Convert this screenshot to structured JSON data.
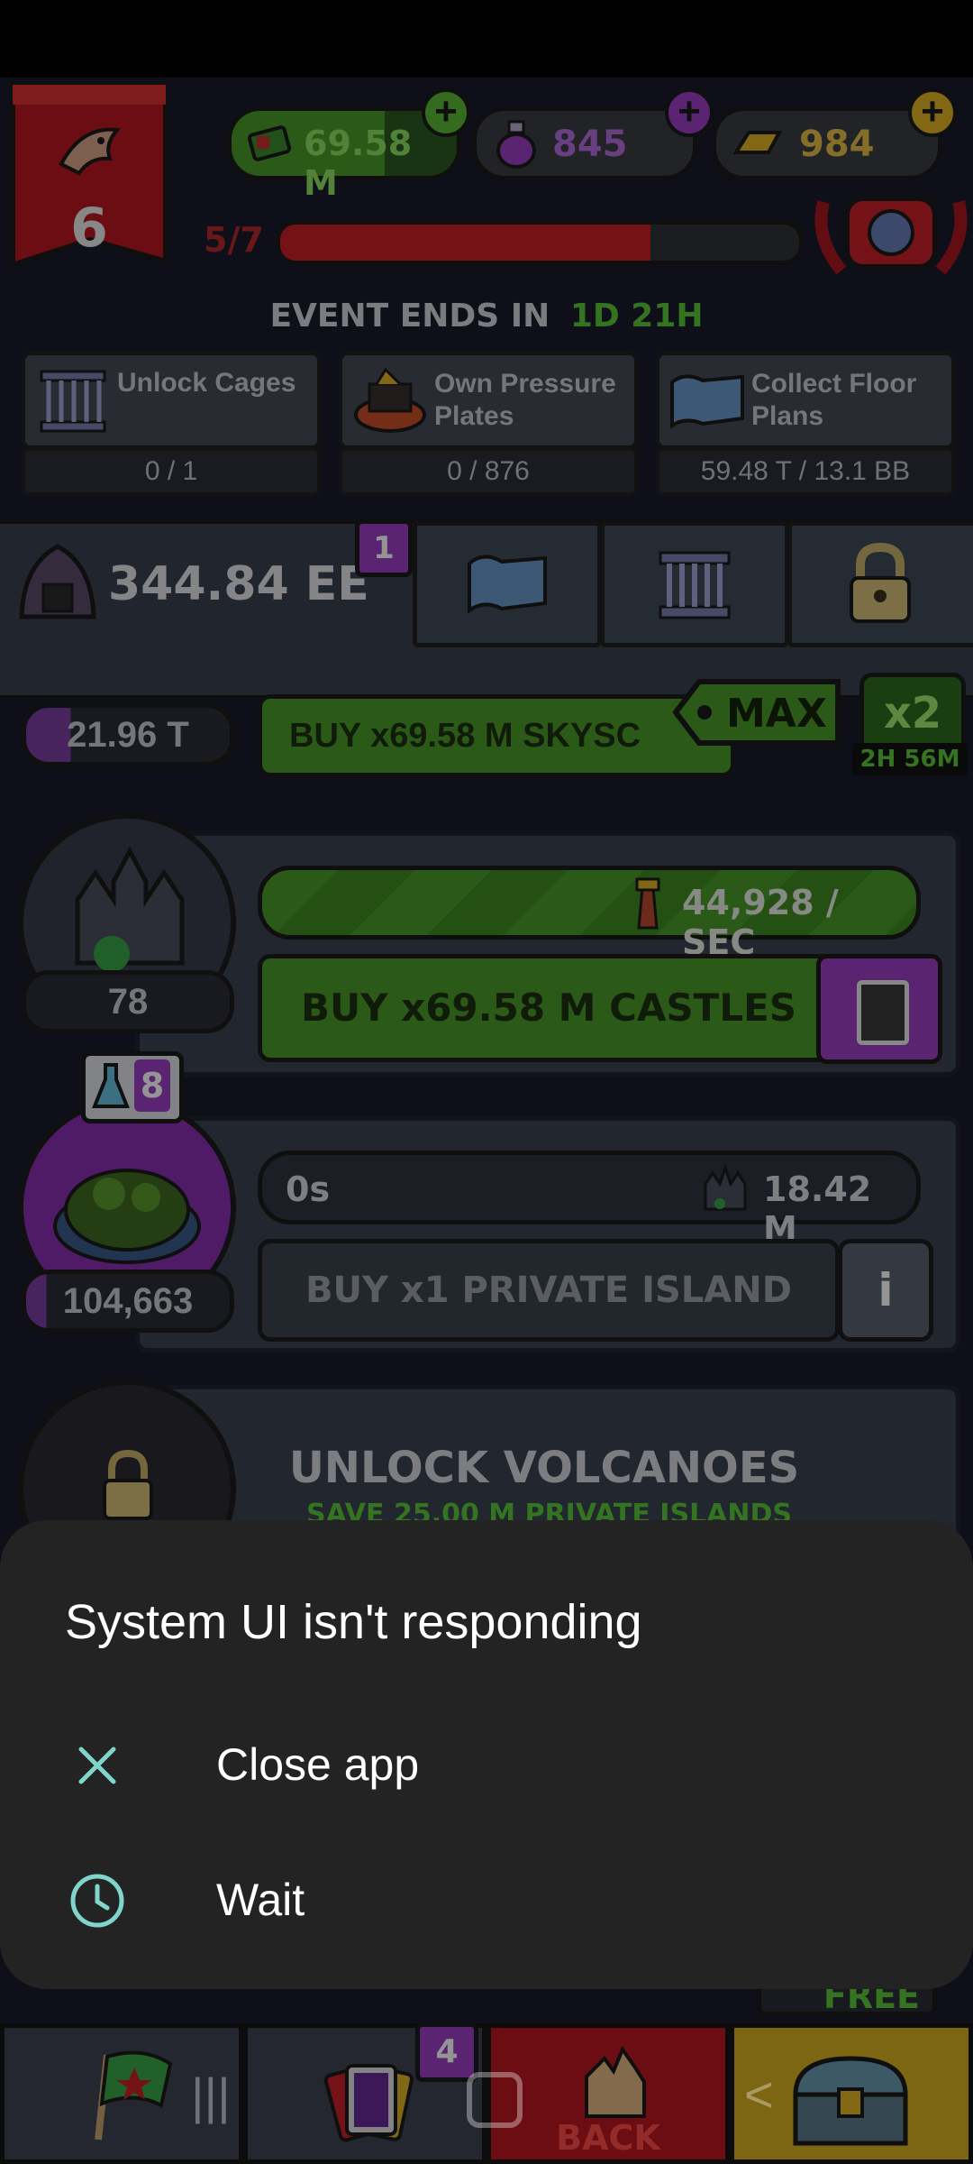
{
  "game": {
    "level": "6",
    "resources": {
      "cash": "69.58 M",
      "potions": "845",
      "gold": "984"
    },
    "progress": {
      "label": "5/7",
      "filled": 5,
      "total": 7
    },
    "event": {
      "prefix": "EVENT ENDS IN",
      "time": "1D 21H"
    },
    "tasks": [
      {
        "label": "Unlock Cages",
        "value": "0 / 1"
      },
      {
        "label": "Own Pressure Plates",
        "value": "0 / 876"
      },
      {
        "label": "Collect Floor Plans",
        "value": "59.48 T / 13.1 BB"
      }
    ],
    "vault": {
      "value": "344.84 EE",
      "badge": "1"
    },
    "skyscraper": {
      "count": "21.96 T",
      "buy": "BUY x69.58 M SKYSC",
      "max": "MAX",
      "boost": "x2",
      "timer": "2H 56M"
    },
    "castles": {
      "count": "78",
      "rate": "44,928 / SEC",
      "buy": "BUY x69.58 M CASTLES"
    },
    "island": {
      "count": "104,663",
      "flask": "8",
      "time": "0s",
      "cost": "18.42 M",
      "buy": "BUY x1 PRIVATE ISLAND",
      "info": "i"
    },
    "volcano": {
      "unlock": "UNLOCK VOLCANOES",
      "sub": "SAVE 25.00 M PRIVATE ISLANDS"
    },
    "bottom": {
      "cards_badge": "4",
      "back": "BACK",
      "free": "FREE"
    }
  },
  "dialog": {
    "title": "System UI isn't responding",
    "options": [
      {
        "label": "Close app",
        "icon": "close-icon"
      },
      {
        "label": "Wait",
        "icon": "clock-icon"
      }
    ],
    "accent": "#7fd4cc"
  },
  "colors": {
    "green": "#5bb834",
    "purple": "#9b3fc4",
    "red": "#c8202a",
    "gold": "#e0b425"
  }
}
